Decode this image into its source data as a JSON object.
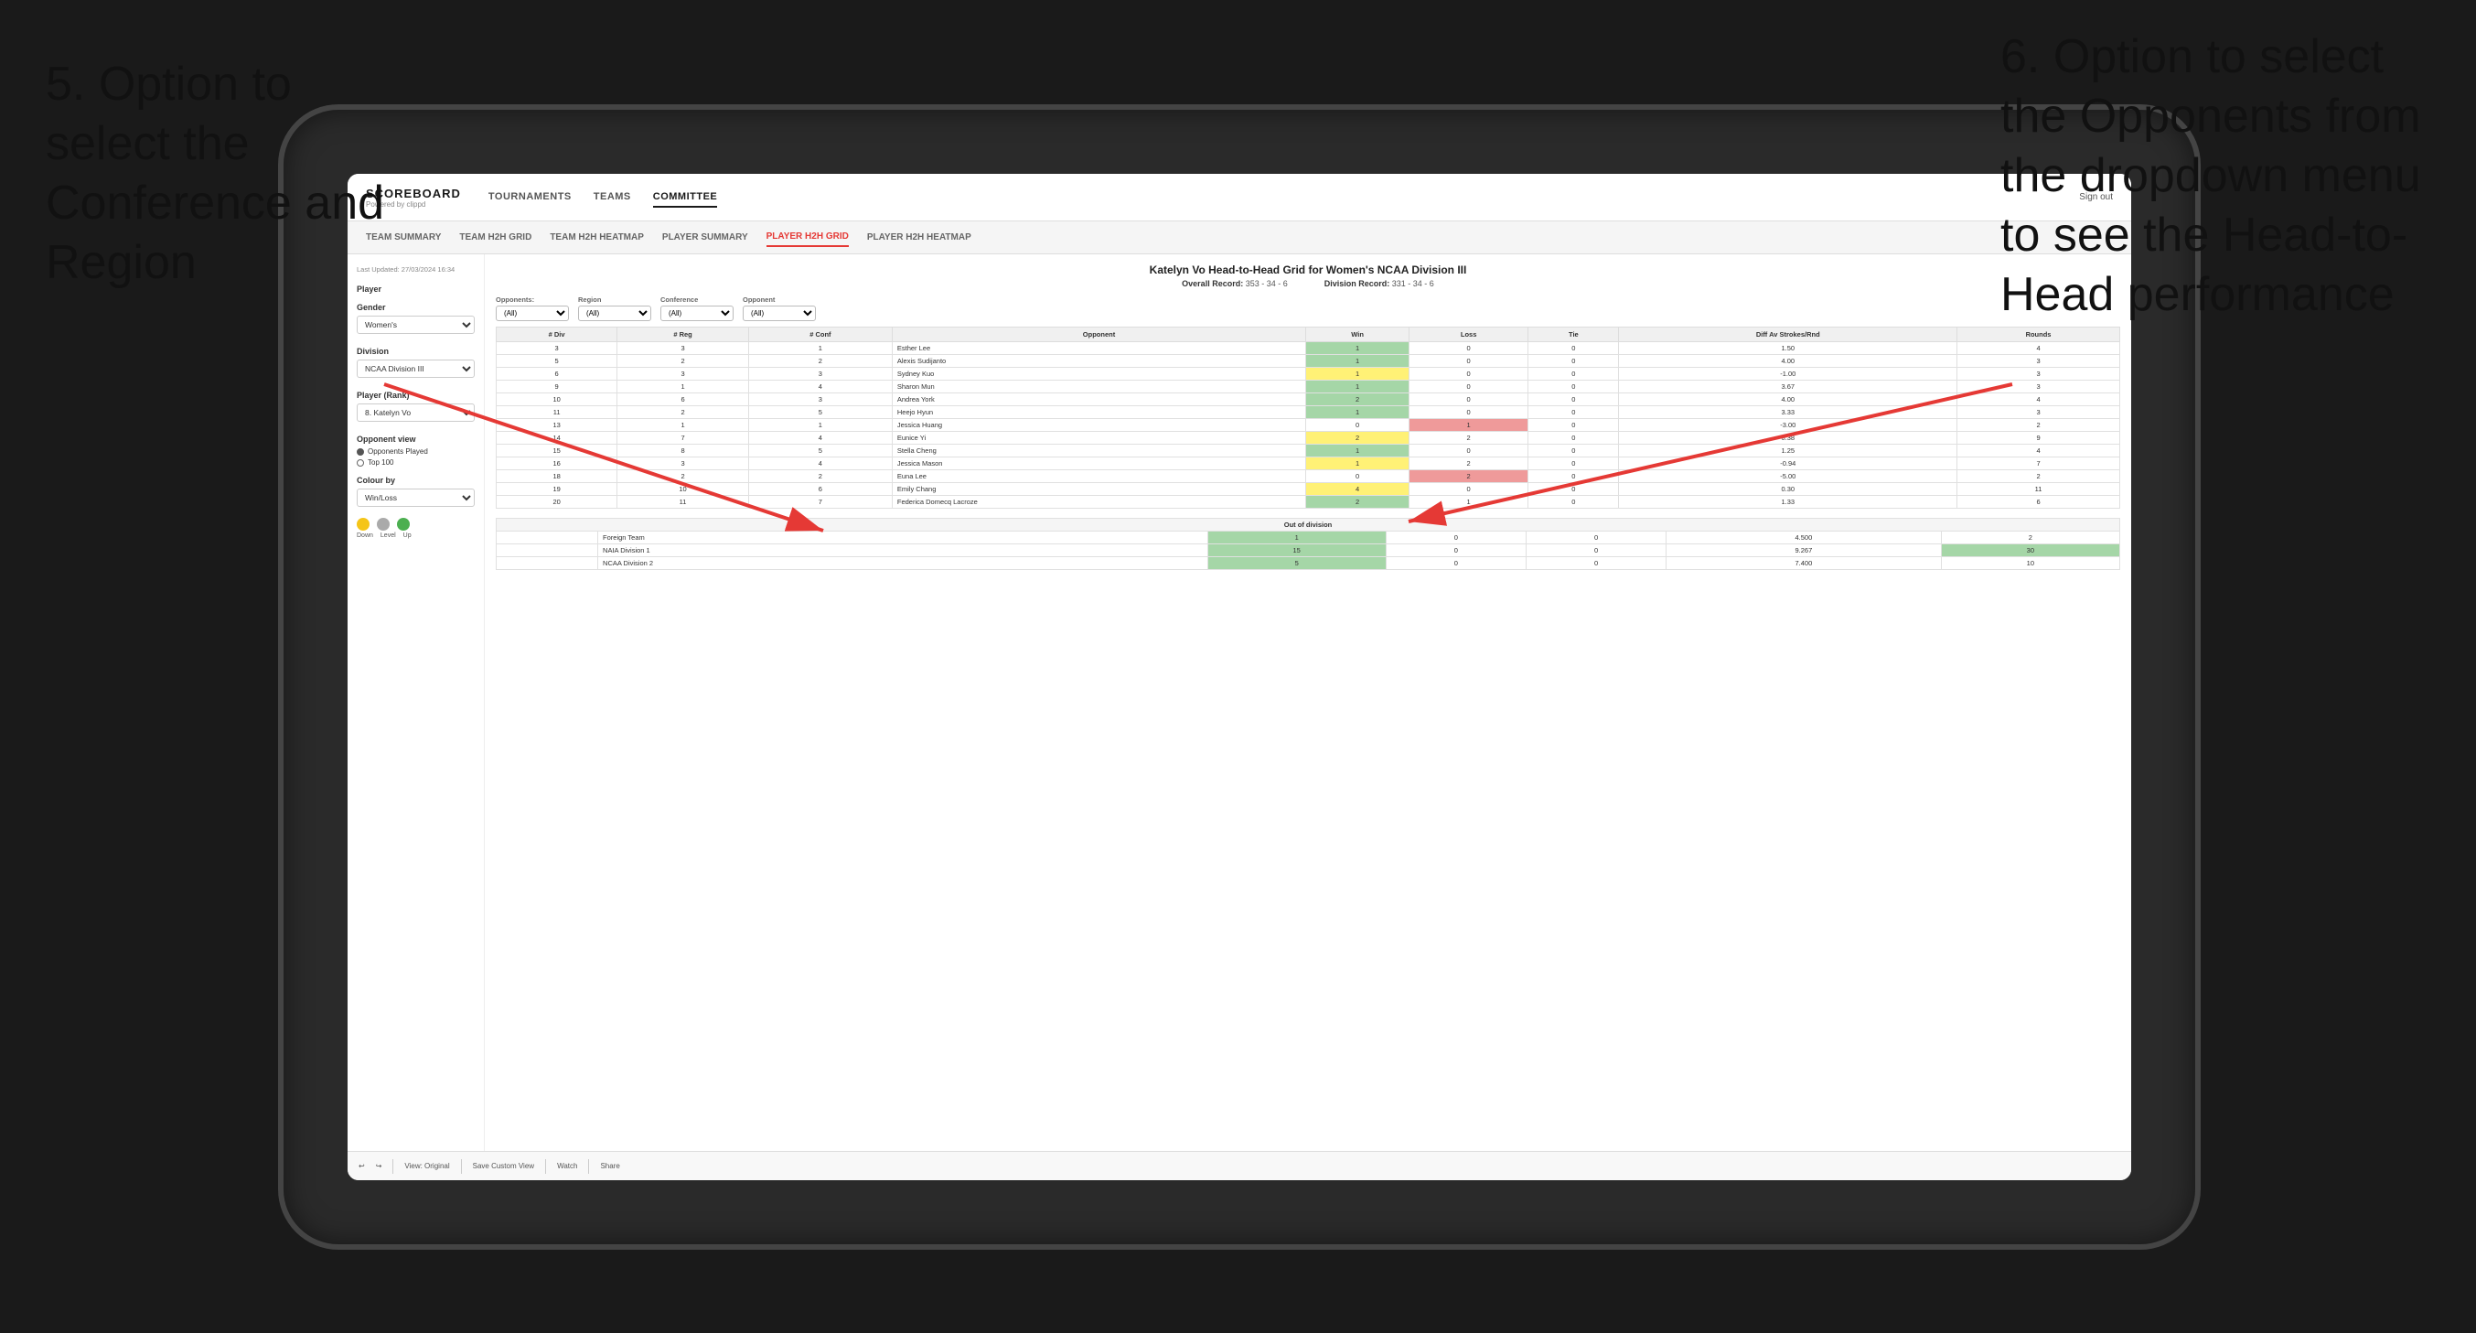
{
  "annotations": {
    "ann5": {
      "text": "5. Option to select the Conference and Region"
    },
    "ann6": {
      "text": "6. Option to select the Opponents from the dropdown menu to see the Head-to-Head performance"
    }
  },
  "nav": {
    "logo": "SCOREBOARD",
    "logo_sub": "Powered by clippd",
    "links": [
      "TOURNAMENTS",
      "TEAMS",
      "COMMITTEE"
    ],
    "sign_out": "Sign out"
  },
  "sub_nav": {
    "links": [
      "TEAM SUMMARY",
      "TEAM H2H GRID",
      "TEAM H2H HEATMAP",
      "PLAYER SUMMARY",
      "PLAYER H2H GRID",
      "PLAYER H2H HEATMAP"
    ]
  },
  "sidebar": {
    "last_updated": "Last Updated: 27/03/2024 16:34",
    "player_label": "Player",
    "gender_label": "Gender",
    "gender_value": "Women's",
    "division_label": "Division",
    "division_value": "NCAA Division III",
    "player_rank_label": "Player (Rank)",
    "player_rank_value": "8. Katelyn Vo",
    "opponent_view_label": "Opponent view",
    "opp_option1": "Opponents Played",
    "opp_option2": "Top 100",
    "colour_label": "Colour by",
    "colour_value": "Win/Loss",
    "legend": {
      "down": "Down",
      "level": "Level",
      "up": "Up"
    }
  },
  "grid": {
    "title": "Katelyn Vo Head-to-Head Grid for Women's NCAA Division III",
    "overall_record_label": "Overall Record:",
    "overall_record": "353 - 34 - 6",
    "division_record_label": "Division Record:",
    "division_record": "331 - 34 - 6",
    "filter_opponents_label": "Opponents:",
    "filter_region_label": "Region",
    "filter_conference_label": "Conference",
    "filter_opponent_label": "Opponent",
    "filter_all": "(All)",
    "columns": [
      "# Div",
      "# Reg",
      "# Conf",
      "Opponent",
      "Win",
      "Loss",
      "Tie",
      "Diff Av Strokes/Rnd",
      "Rounds"
    ],
    "rows": [
      {
        "div": 3,
        "reg": 3,
        "conf": 1,
        "opponent": "Esther Lee",
        "win": 1,
        "loss": 0,
        "tie": 0,
        "diff": 1.5,
        "rounds": 4,
        "win_color": "green",
        "loss_color": "",
        "tie_color": ""
      },
      {
        "div": 5,
        "reg": 2,
        "conf": 2,
        "opponent": "Alexis Sudijanto",
        "win": 1,
        "loss": 0,
        "tie": 0,
        "diff": 4.0,
        "rounds": 3,
        "win_color": "green"
      },
      {
        "div": 6,
        "reg": 3,
        "conf": 3,
        "opponent": "Sydney Kuo",
        "win": 1,
        "loss": 0,
        "tie": 0,
        "diff": -1.0,
        "rounds": 3,
        "win_color": "yellow"
      },
      {
        "div": 9,
        "reg": 1,
        "conf": 4,
        "opponent": "Sharon Mun",
        "win": 1,
        "loss": 0,
        "tie": 0,
        "diff": 3.67,
        "rounds": 3,
        "win_color": "green"
      },
      {
        "div": 10,
        "reg": 6,
        "conf": 3,
        "opponent": "Andrea York",
        "win": 2,
        "loss": 0,
        "tie": 0,
        "diff": 4.0,
        "rounds": 4,
        "win_color": "green"
      },
      {
        "div": 11,
        "reg": 2,
        "conf": 5,
        "opponent": "Heejo Hyun",
        "win": 1,
        "loss": 0,
        "tie": 0,
        "diff": 3.33,
        "rounds": 3,
        "win_color": "green"
      },
      {
        "div": 13,
        "reg": 1,
        "conf": 1,
        "opponent": "Jessica Huang",
        "win": 0,
        "loss": 1,
        "tie": 0,
        "diff": -3.0,
        "rounds": 2,
        "win_color": "",
        "loss_color": "red"
      },
      {
        "div": 14,
        "reg": 7,
        "conf": 4,
        "opponent": "Eunice Yi",
        "win": 2,
        "loss": 2,
        "tie": 0,
        "diff": 0.38,
        "rounds": 9,
        "win_color": "yellow"
      },
      {
        "div": 15,
        "reg": 8,
        "conf": 5,
        "opponent": "Stella Cheng",
        "win": 1,
        "loss": 0,
        "tie": 0,
        "diff": 1.25,
        "rounds": 4,
        "win_color": "green"
      },
      {
        "div": 16,
        "reg": 3,
        "conf": 4,
        "opponent": "Jessica Mason",
        "win": 1,
        "loss": 2,
        "tie": 0,
        "diff": -0.94,
        "rounds": 7,
        "win_color": "yellow"
      },
      {
        "div": 18,
        "reg": 2,
        "conf": 2,
        "opponent": "Euna Lee",
        "win": 0,
        "loss": 2,
        "tie": 0,
        "diff": -5.0,
        "rounds": 2,
        "win_color": "",
        "loss_color": "red"
      },
      {
        "div": 19,
        "reg": 10,
        "conf": 6,
        "opponent": "Emily Chang",
        "win": 4,
        "loss": 0,
        "tie": 0,
        "diff": 0.3,
        "rounds": 11,
        "win_color": "yellow"
      },
      {
        "div": 20,
        "reg": 11,
        "conf": 7,
        "opponent": "Federica Domecq Lacroze",
        "win": 2,
        "loss": 1,
        "tie": 0,
        "diff": 1.33,
        "rounds": 6,
        "win_color": "green"
      }
    ],
    "out_of_division_label": "Out of division",
    "out_of_division_rows": [
      {
        "opponent": "Foreign Team",
        "win": 1,
        "loss": 0,
        "tie": 0,
        "diff": 4.5,
        "rounds": 2
      },
      {
        "opponent": "NAIA Division 1",
        "win": 15,
        "loss": 0,
        "tie": 0,
        "diff": 9.267,
        "rounds": 30
      },
      {
        "opponent": "NCAA Division 2",
        "win": 5,
        "loss": 0,
        "tie": 0,
        "diff": 7.4,
        "rounds": 10
      }
    ]
  },
  "toolbar": {
    "view_original": "View: Original",
    "save_custom": "Save Custom View",
    "watch": "Watch",
    "share": "Share"
  }
}
